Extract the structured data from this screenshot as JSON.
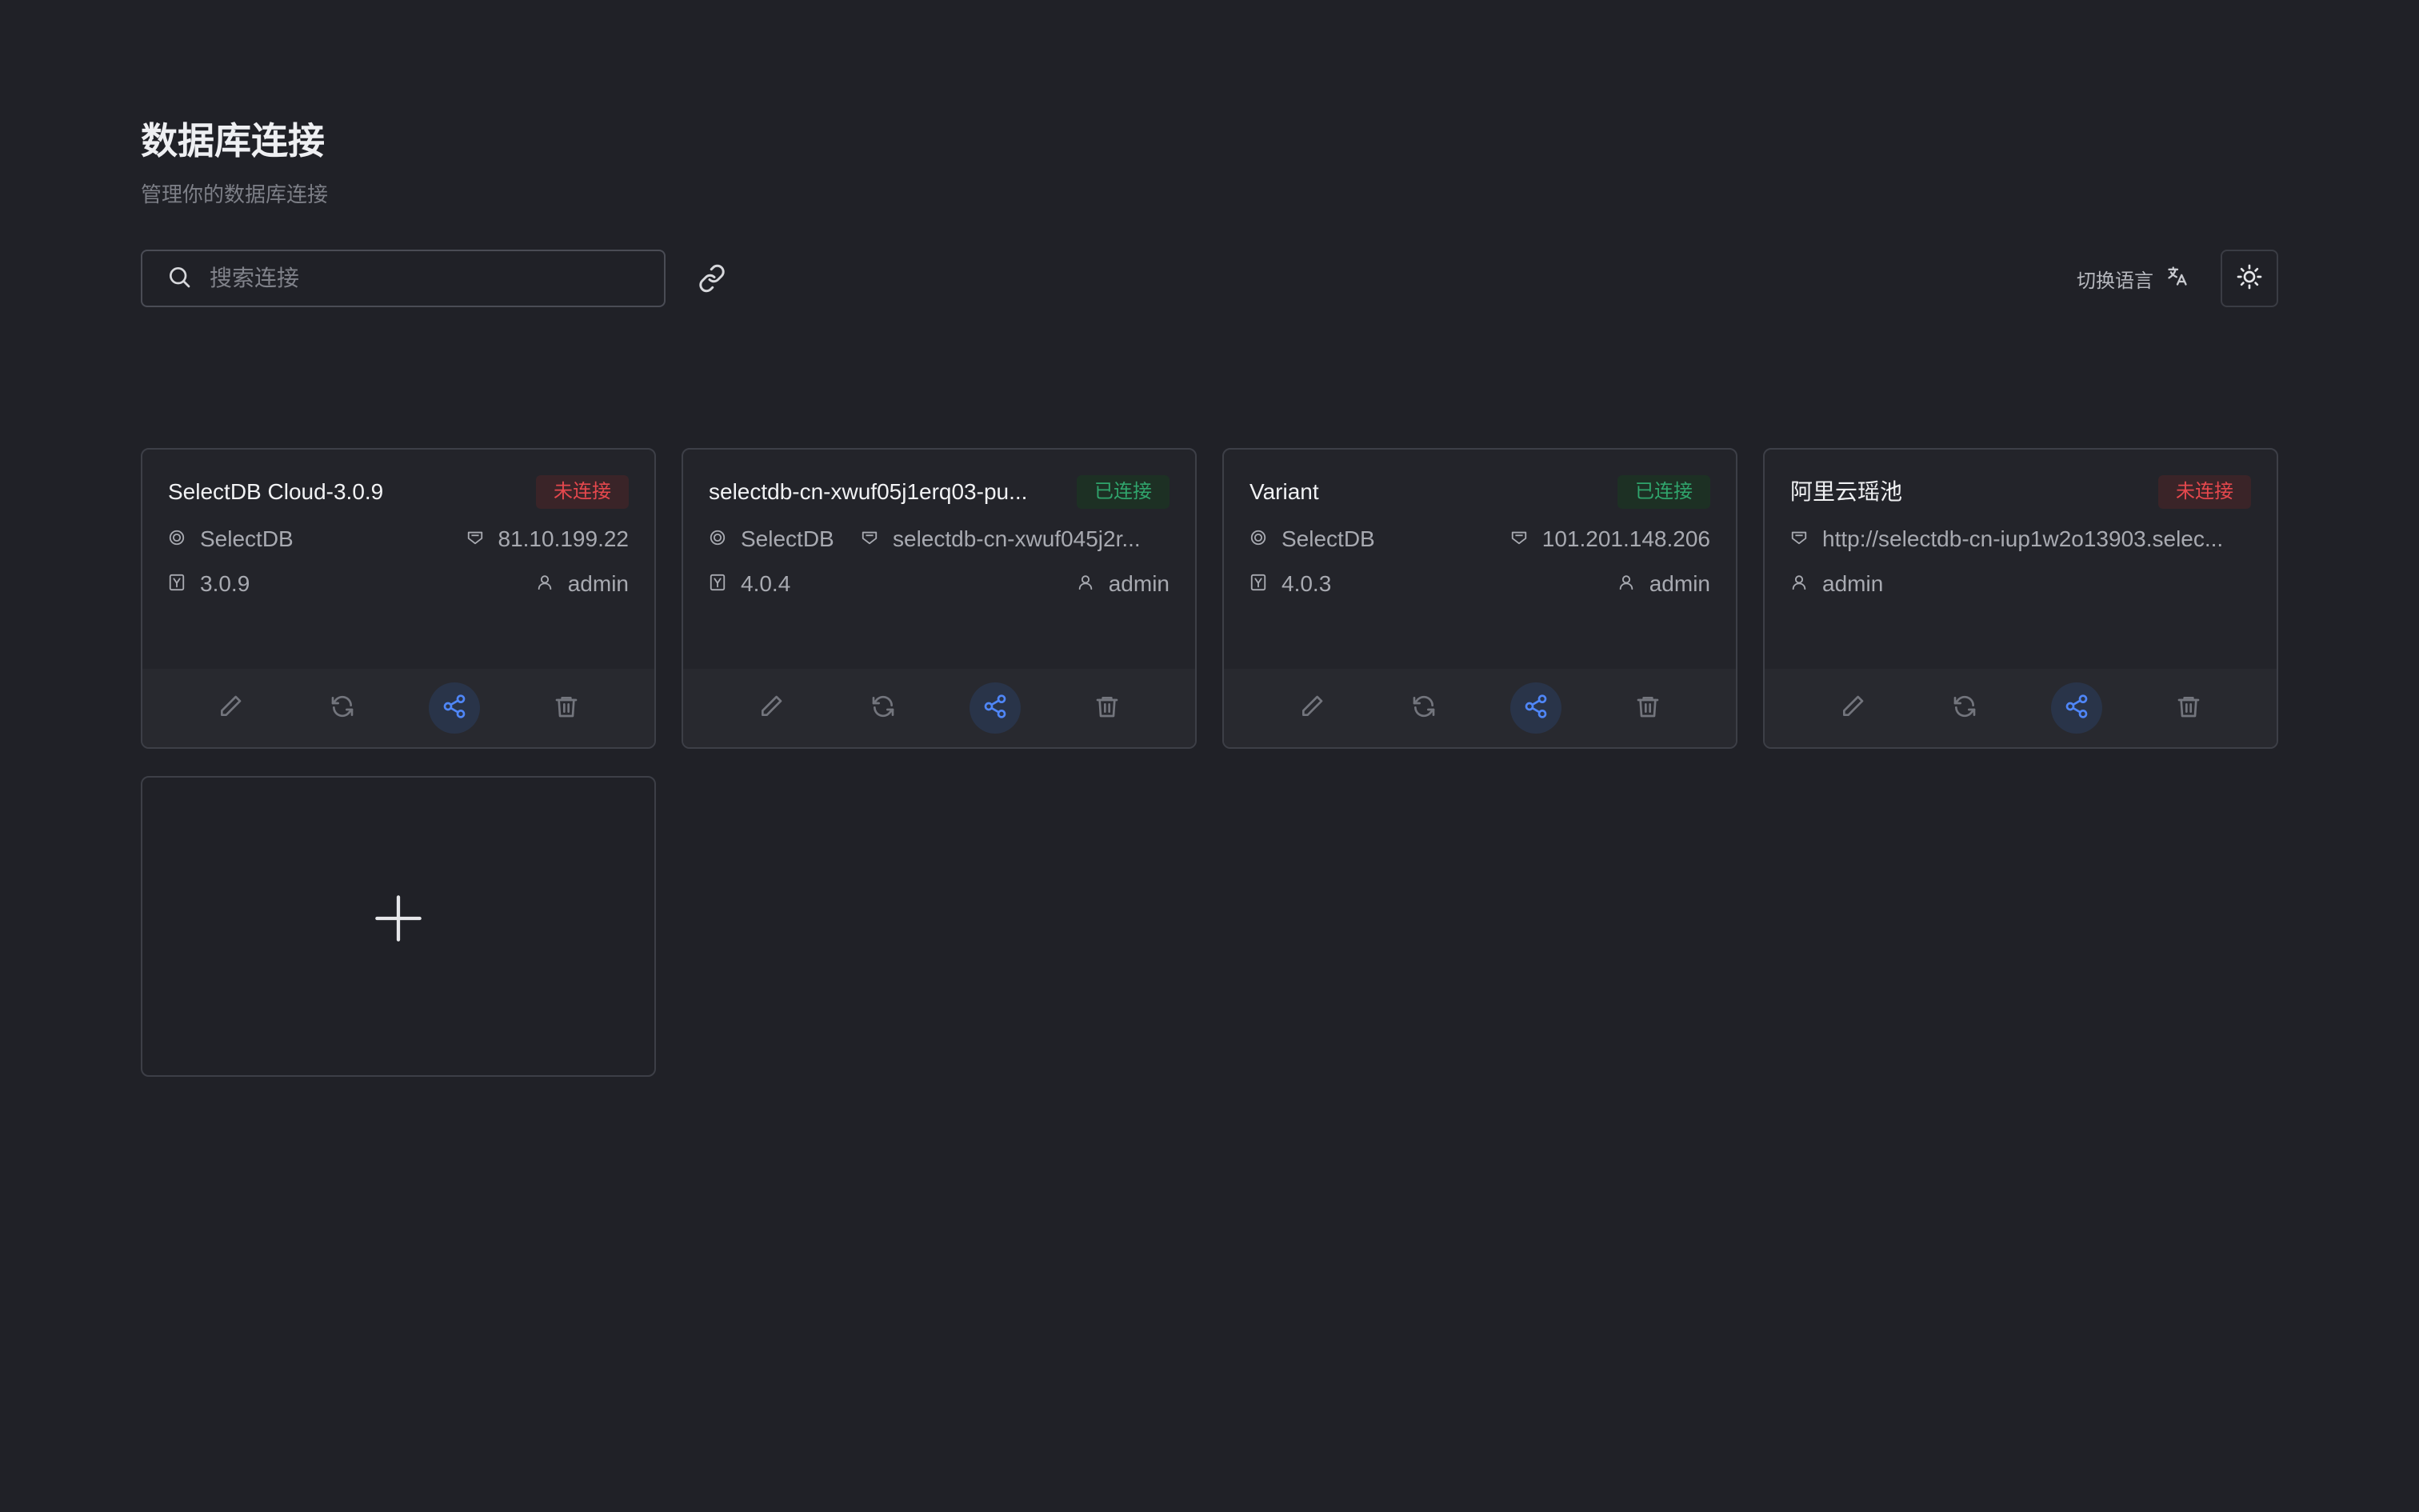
{
  "header": {
    "title": "数据库连接",
    "subtitle": "管理你的数据库连接"
  },
  "toolbar": {
    "search_placeholder": "搜索连接",
    "language_label": "切换语言"
  },
  "colors": {
    "background": "#202127",
    "disconnected": "#e5484d",
    "connected": "#30a46c",
    "share_accent": "#4f86f7"
  },
  "cards": [
    {
      "name": "SelectDB Cloud-3.0.9",
      "status": "未连接",
      "type": "SelectDB",
      "host": "81.10.199.22",
      "version": "3.0.9",
      "user": "admin"
    },
    {
      "name": "selectdb-cn-xwuf05j1erq03-pu...",
      "status": "已连接",
      "type": "SelectDB",
      "host": "selectdb-cn-xwuf045j2r...",
      "version": "4.0.4",
      "user": "admin"
    },
    {
      "name": "Variant",
      "status": "已连接",
      "type": "SelectDB",
      "host": "101.201.148.206",
      "version": "4.0.3",
      "user": "admin"
    },
    {
      "name": "阿里云瑶池",
      "status": "未连接",
      "host": "http://selectdb-cn-iup1w2o13903.selec...",
      "user": "admin"
    }
  ]
}
